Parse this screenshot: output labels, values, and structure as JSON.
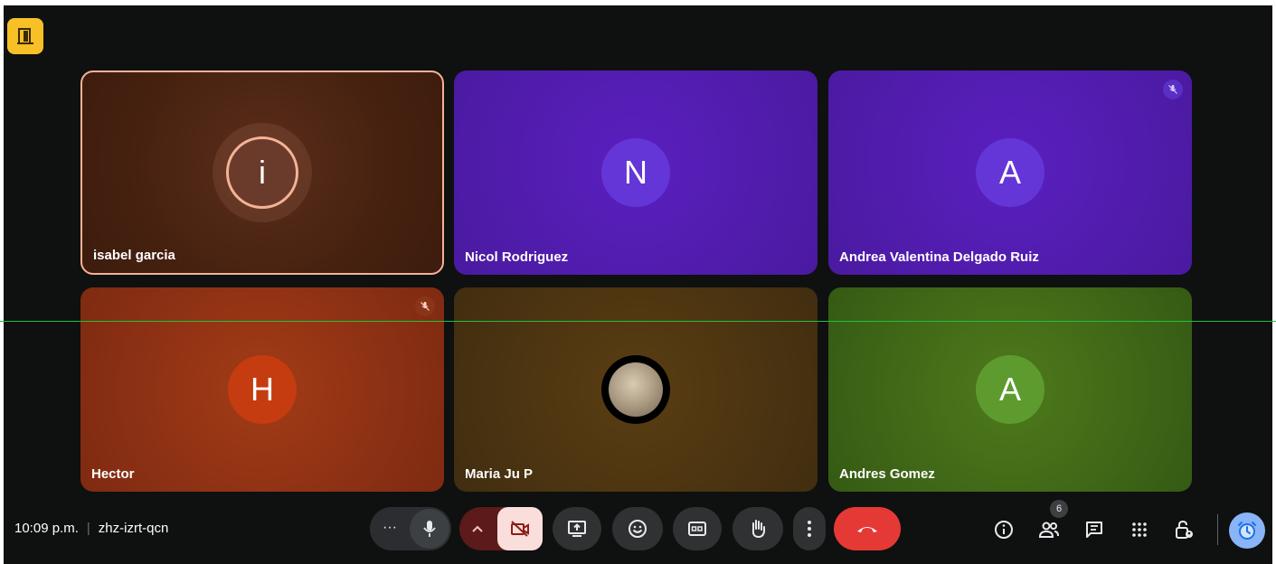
{
  "app_badge_icon": "door-exit-icon",
  "participants": [
    {
      "name": "isabel garcia",
      "initial": "i",
      "color": "#8a4a37",
      "speaking": true,
      "muted": false
    },
    {
      "name": "Nicol Rodriguez",
      "initial": "N",
      "color": "#6436d7",
      "muted": false
    },
    {
      "name": "Andrea Valentina Delgado Ruiz",
      "initial": "A",
      "color": "#6436d7",
      "muted": true
    },
    {
      "name": "Hector",
      "initial": "H",
      "color": "#c53c10",
      "muted": true
    },
    {
      "name": "Maria Ju P",
      "initial": "",
      "avatar": "moon-photo",
      "muted": false
    },
    {
      "name": "Andres Gomez",
      "initial": "A",
      "color": "#5e9b2e",
      "muted": false
    }
  ],
  "meeting": {
    "time": "10:09 p.m.",
    "separator": "|",
    "code": "zhz-izrt-qcn"
  },
  "controls": {
    "more_options_label": "···",
    "participant_count": "6"
  }
}
